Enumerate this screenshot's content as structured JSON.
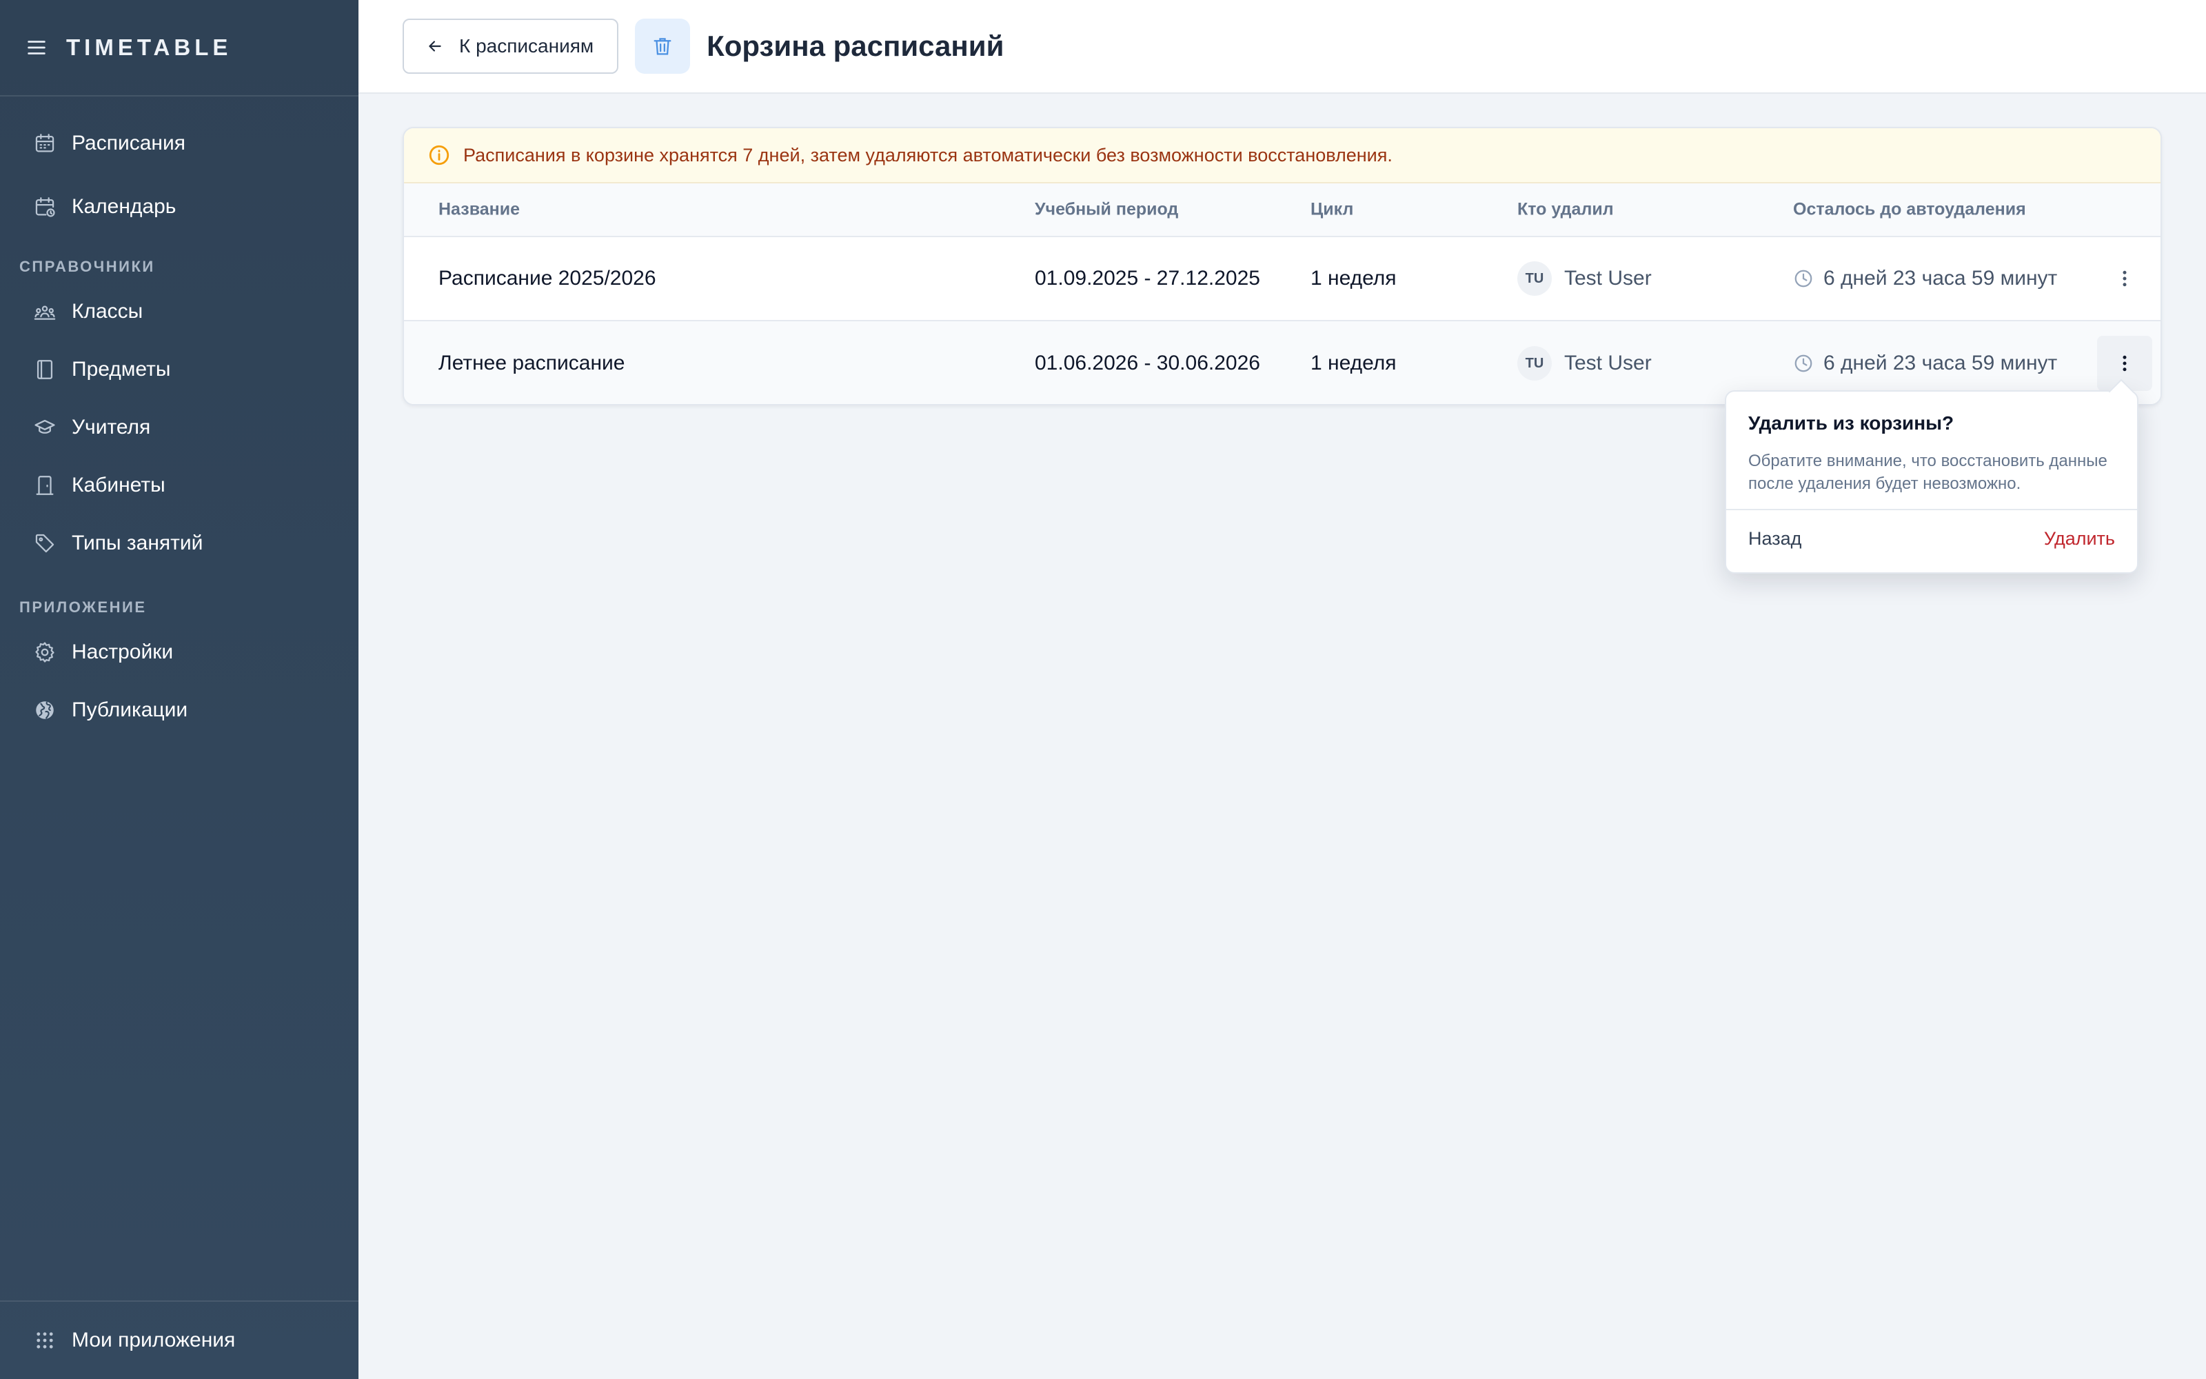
{
  "sidebar": {
    "brand": "TIMETABLE",
    "items_main": [
      {
        "label": "Расписания",
        "icon": "calendar-icon"
      },
      {
        "label": "Календарь",
        "icon": "calendar-clock-icon"
      }
    ],
    "section_refs": "СПРАВОЧНИКИ",
    "items_refs": [
      {
        "label": "Классы",
        "icon": "group-icon"
      },
      {
        "label": "Предметы",
        "icon": "book-icon"
      },
      {
        "label": "Учителя",
        "icon": "graduation-cap-icon"
      },
      {
        "label": "Кабинеты",
        "icon": "door-icon"
      },
      {
        "label": "Типы занятий",
        "icon": "tag-icon"
      }
    ],
    "section_app": "ПРИЛОЖЕНИЕ",
    "items_app": [
      {
        "label": "Настройки",
        "icon": "gear-icon"
      },
      {
        "label": "Публикации",
        "icon": "globe-icon"
      }
    ],
    "footer": {
      "label": "Мои приложения",
      "icon": "grid-icon"
    }
  },
  "topbar": {
    "back_label": "К расписаниям",
    "title": "Корзина расписаний"
  },
  "alert": "Расписания в корзине хранятся 7 дней, затем удаляются автоматически без возможности восстановления.",
  "table": {
    "headers": [
      "Название",
      "Учебный период",
      "Цикл",
      "Кто удалил",
      "Осталось до автоудаления"
    ],
    "rows": [
      {
        "name": "Расписание 2025/2026",
        "period": "01.09.2025 - 27.12.2025",
        "cycle": "1 неделя",
        "initials": "TU",
        "user": "Test User",
        "remaining": "6 дней 23 часа 59 минут"
      },
      {
        "name": "Летнее расписание",
        "period": "01.06.2026 - 30.06.2026",
        "cycle": "1 неделя",
        "initials": "TU",
        "user": "Test User",
        "remaining": "6 дней 23 часа 59 минут"
      }
    ]
  },
  "popover": {
    "title": "Удалить из корзины?",
    "body": "Обратите внимание, что восстановить данные после удаления будет невозможно.",
    "back": "Назад",
    "delete": "Удалить"
  },
  "colors": {
    "sidebar_bg": "#2f4256",
    "alert_bg": "#fefbea",
    "alert_text": "#9a3412",
    "alert_icon": "#f59e0b",
    "danger": "#c0262d",
    "accent": "#3b82f6"
  }
}
